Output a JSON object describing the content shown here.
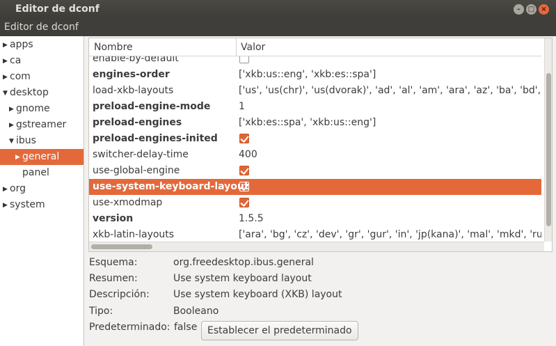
{
  "window": {
    "title": "Editor de dconf",
    "controls": {
      "minimize": "–",
      "maximize": "□",
      "close": "×"
    }
  },
  "menubar": {
    "app_menu": "Editor de dconf"
  },
  "sidebar": {
    "items": [
      {
        "label": "apps",
        "expander": "collapsed"
      },
      {
        "label": "ca",
        "expander": "collapsed"
      },
      {
        "label": "com",
        "expander": "collapsed"
      },
      {
        "label": "desktop",
        "expander": "expanded"
      },
      {
        "label": "gnome",
        "expander": "collapsed"
      },
      {
        "label": "gstreamer",
        "expander": "collapsed"
      },
      {
        "label": "ibus",
        "expander": "expanded"
      },
      {
        "label": "general",
        "expander": "collapsed",
        "selected": true
      },
      {
        "label": "panel",
        "expander": "none"
      },
      {
        "label": "org",
        "expander": "collapsed"
      },
      {
        "label": "system",
        "expander": "collapsed"
      }
    ]
  },
  "table": {
    "columns": {
      "name": "Nombre",
      "value": "Valor"
    },
    "rows": [
      {
        "key": "enable-by-default",
        "bold": false,
        "type": "bool",
        "checked": false
      },
      {
        "key": "engines-order",
        "bold": true,
        "type": "text",
        "value": "['xkb:us::eng', 'xkb:es::spa']"
      },
      {
        "key": "load-xkb-layouts",
        "bold": false,
        "type": "text",
        "value": "['us', 'us(chr)', 'us(dvorak)', 'ad', 'al', 'am', 'ara', 'az', 'ba', 'bd', 'be',"
      },
      {
        "key": "preload-engine-mode",
        "bold": true,
        "type": "text",
        "value": "1"
      },
      {
        "key": "preload-engines",
        "bold": true,
        "type": "text",
        "value": "['xkb:es::spa', 'xkb:us::eng']"
      },
      {
        "key": "preload-engines-inited",
        "bold": true,
        "type": "bool",
        "checked": true
      },
      {
        "key": "switcher-delay-time",
        "bold": false,
        "type": "text",
        "value": "400"
      },
      {
        "key": "use-global-engine",
        "bold": false,
        "type": "bool",
        "checked": true
      },
      {
        "key": "use-system-keyboard-layout",
        "bold": true,
        "type": "bool",
        "checked": true,
        "selected": true
      },
      {
        "key": "use-xmodmap",
        "bold": false,
        "type": "bool",
        "checked": true
      },
      {
        "key": "version",
        "bold": true,
        "type": "text",
        "value": "1.5.5"
      },
      {
        "key": "xkb-latin-layouts",
        "bold": false,
        "type": "text",
        "value": "['ara', 'bg', 'cz', 'dev', 'gr', 'gur', 'in', 'jp(kana)', 'mal', 'mkd', 'ru', 'ua"
      }
    ]
  },
  "details": {
    "schema_label": "Esquema:",
    "schema_value": "org.freedesktop.ibus.general",
    "summary_label": "Resumen:",
    "summary_value": "Use system keyboard layout",
    "description_label": "Descripción:",
    "description_value": "Use system keyboard (XKB) layout",
    "type_label": "Tipo:",
    "type_value": "Booleano",
    "default_label": "Predeterminado:",
    "default_value": "false",
    "set_default_button": "Establecer el predeterminado"
  },
  "colors": {
    "selection": "#e3693b",
    "titlebar": "#3f3e3a",
    "checkbox": "#e06734"
  },
  "icons": {
    "expander_collapsed": "▶",
    "expander_expanded": "▼"
  }
}
